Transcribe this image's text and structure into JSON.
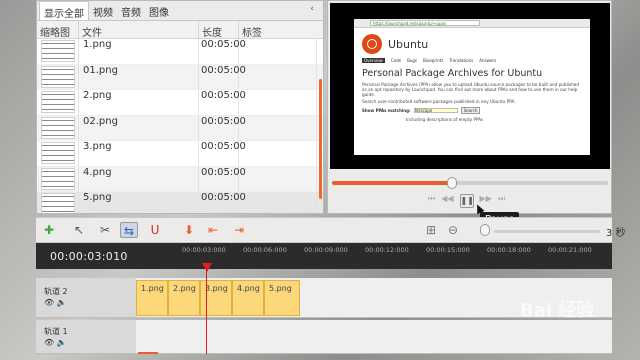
{
  "library": {
    "tabs": [
      "显示全部",
      "视频",
      "音频",
      "图像"
    ],
    "active_tab": 0,
    "menu_icon": "chevron-left-icon",
    "columns": [
      "缩略图",
      "文件",
      "长度",
      "标签"
    ],
    "rows": [
      {
        "file": "1.png",
        "length": "00:05:00"
      },
      {
        "file": "01.png",
        "length": "00:05:00"
      },
      {
        "file": "2.png",
        "length": "00:05:00"
      },
      {
        "file": "02.png",
        "length": "00:05:00"
      },
      {
        "file": "3.png",
        "length": "00:05:00"
      },
      {
        "file": "4.png",
        "length": "00:05:00"
      },
      {
        "file": "5.png",
        "length": "00:05:00"
      }
    ]
  },
  "preview": {
    "url": "https://launchpad.net/ubuntu/+ppas",
    "brand": "Ubuntu",
    "nav": [
      "Overview",
      "Code",
      "Bugs",
      "Blueprints",
      "Translations",
      "Answers"
    ],
    "title": "Personal Package Archives for Ubuntu",
    "para1": "Personal Package Archives (PPA) allow you to upload Ubuntu source packages to be built and published as an apt repository by Launchpad. You can find out more about PPAs and how to use them in our help guide.",
    "para2": "Search user-contributed software packages published in any Ubuntu PPA.",
    "search_label": "Show PPAs matching:",
    "search_value": "Inkscape",
    "search_button": "Search",
    "checkbox_label": "Including descriptions of empty PPAs",
    "progress": 0.44,
    "pause_tooltip": "Pause"
  },
  "toolbar": {
    "zoom_label": "3 秒"
  },
  "timeline": {
    "timecode": "00:00:03:010",
    "ticks": [
      "00:00:03:000",
      "00:00:06:000",
      "00:00:09:000",
      "00:00:12:000",
      "00:00:15:000",
      "00:00:18:000",
      "00:00:21:000"
    ],
    "tracks": [
      {
        "name": "轨道 2",
        "clips": [
          "1.png",
          "2.png",
          "3.png",
          "4.png",
          "5.png"
        ]
      },
      {
        "name": "轨道 1",
        "clips": []
      }
    ]
  },
  "colors": {
    "accent": "#e5602c",
    "playhead": "#e02020",
    "clip": "#fcd87a",
    "ubuntu_orange": "#dd4814"
  },
  "watermark": "Bai 经验"
}
